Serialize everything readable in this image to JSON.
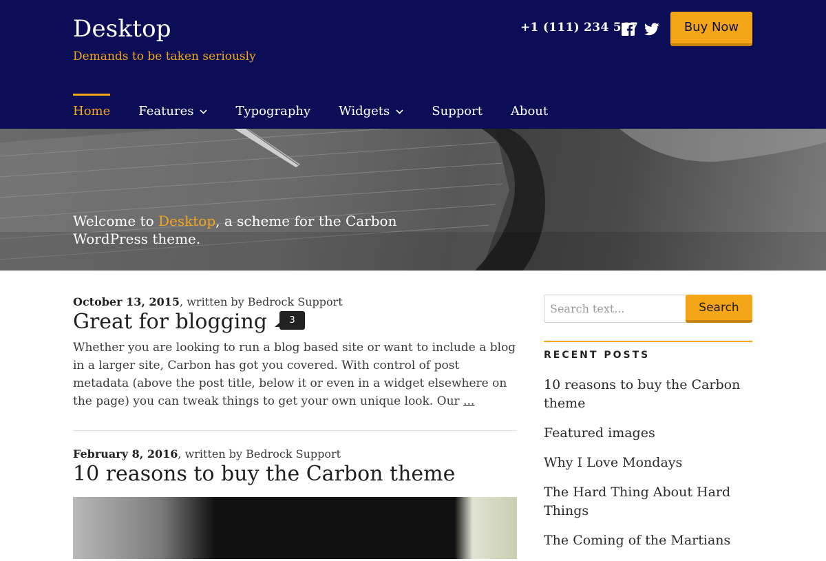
{
  "header": {
    "site_title": "Desktop",
    "tagline": "Demands to be taken seriously",
    "phone": "+1 (111) 234 567",
    "buy_label": "Buy Now",
    "social": [
      "facebook-icon",
      "twitter-icon"
    ]
  },
  "nav": {
    "items": [
      {
        "label": "Home",
        "active": true
      },
      {
        "label": "Features",
        "dropdown": true
      },
      {
        "label": "Typography"
      },
      {
        "label": "Widgets",
        "dropdown": true
      },
      {
        "label": "Support"
      },
      {
        "label": "About"
      }
    ]
  },
  "hero": {
    "welcome_prefix": "Welcome to ",
    "welcome_accent": "Desktop",
    "welcome_suffix": ", a scheme for the Carbon WordPress theme."
  },
  "posts": [
    {
      "date": "October 13, 2015",
      "byline": ", written by Bedrock Support",
      "title": "Great for blogging",
      "comments": "3",
      "excerpt": "Whether you are looking to run a blog based site or want to include a blog in a larger site, Carbon has got you covered. With control of post metadata (above the post title, below it or even in a widget elsewhere on the page) you can tweak things to get your own unique look. Our ",
      "more": "..."
    },
    {
      "date": "February 8, 2016",
      "byline": ", written by Bedrock Support",
      "title": "10 reasons to buy the Carbon theme"
    }
  ],
  "sidebar": {
    "search_placeholder": "Search text...",
    "search_button": "Search",
    "recent_title": "RECENT POSTS",
    "recent_posts": [
      "10 reasons to buy the Carbon theme",
      "Featured images",
      "Why I Love Mondays",
      "The Hard Thing About Hard Things",
      "The Coming of the Martians"
    ]
  },
  "colors": {
    "header_bg": "#0b0e57",
    "accent": "#f3a61a"
  }
}
